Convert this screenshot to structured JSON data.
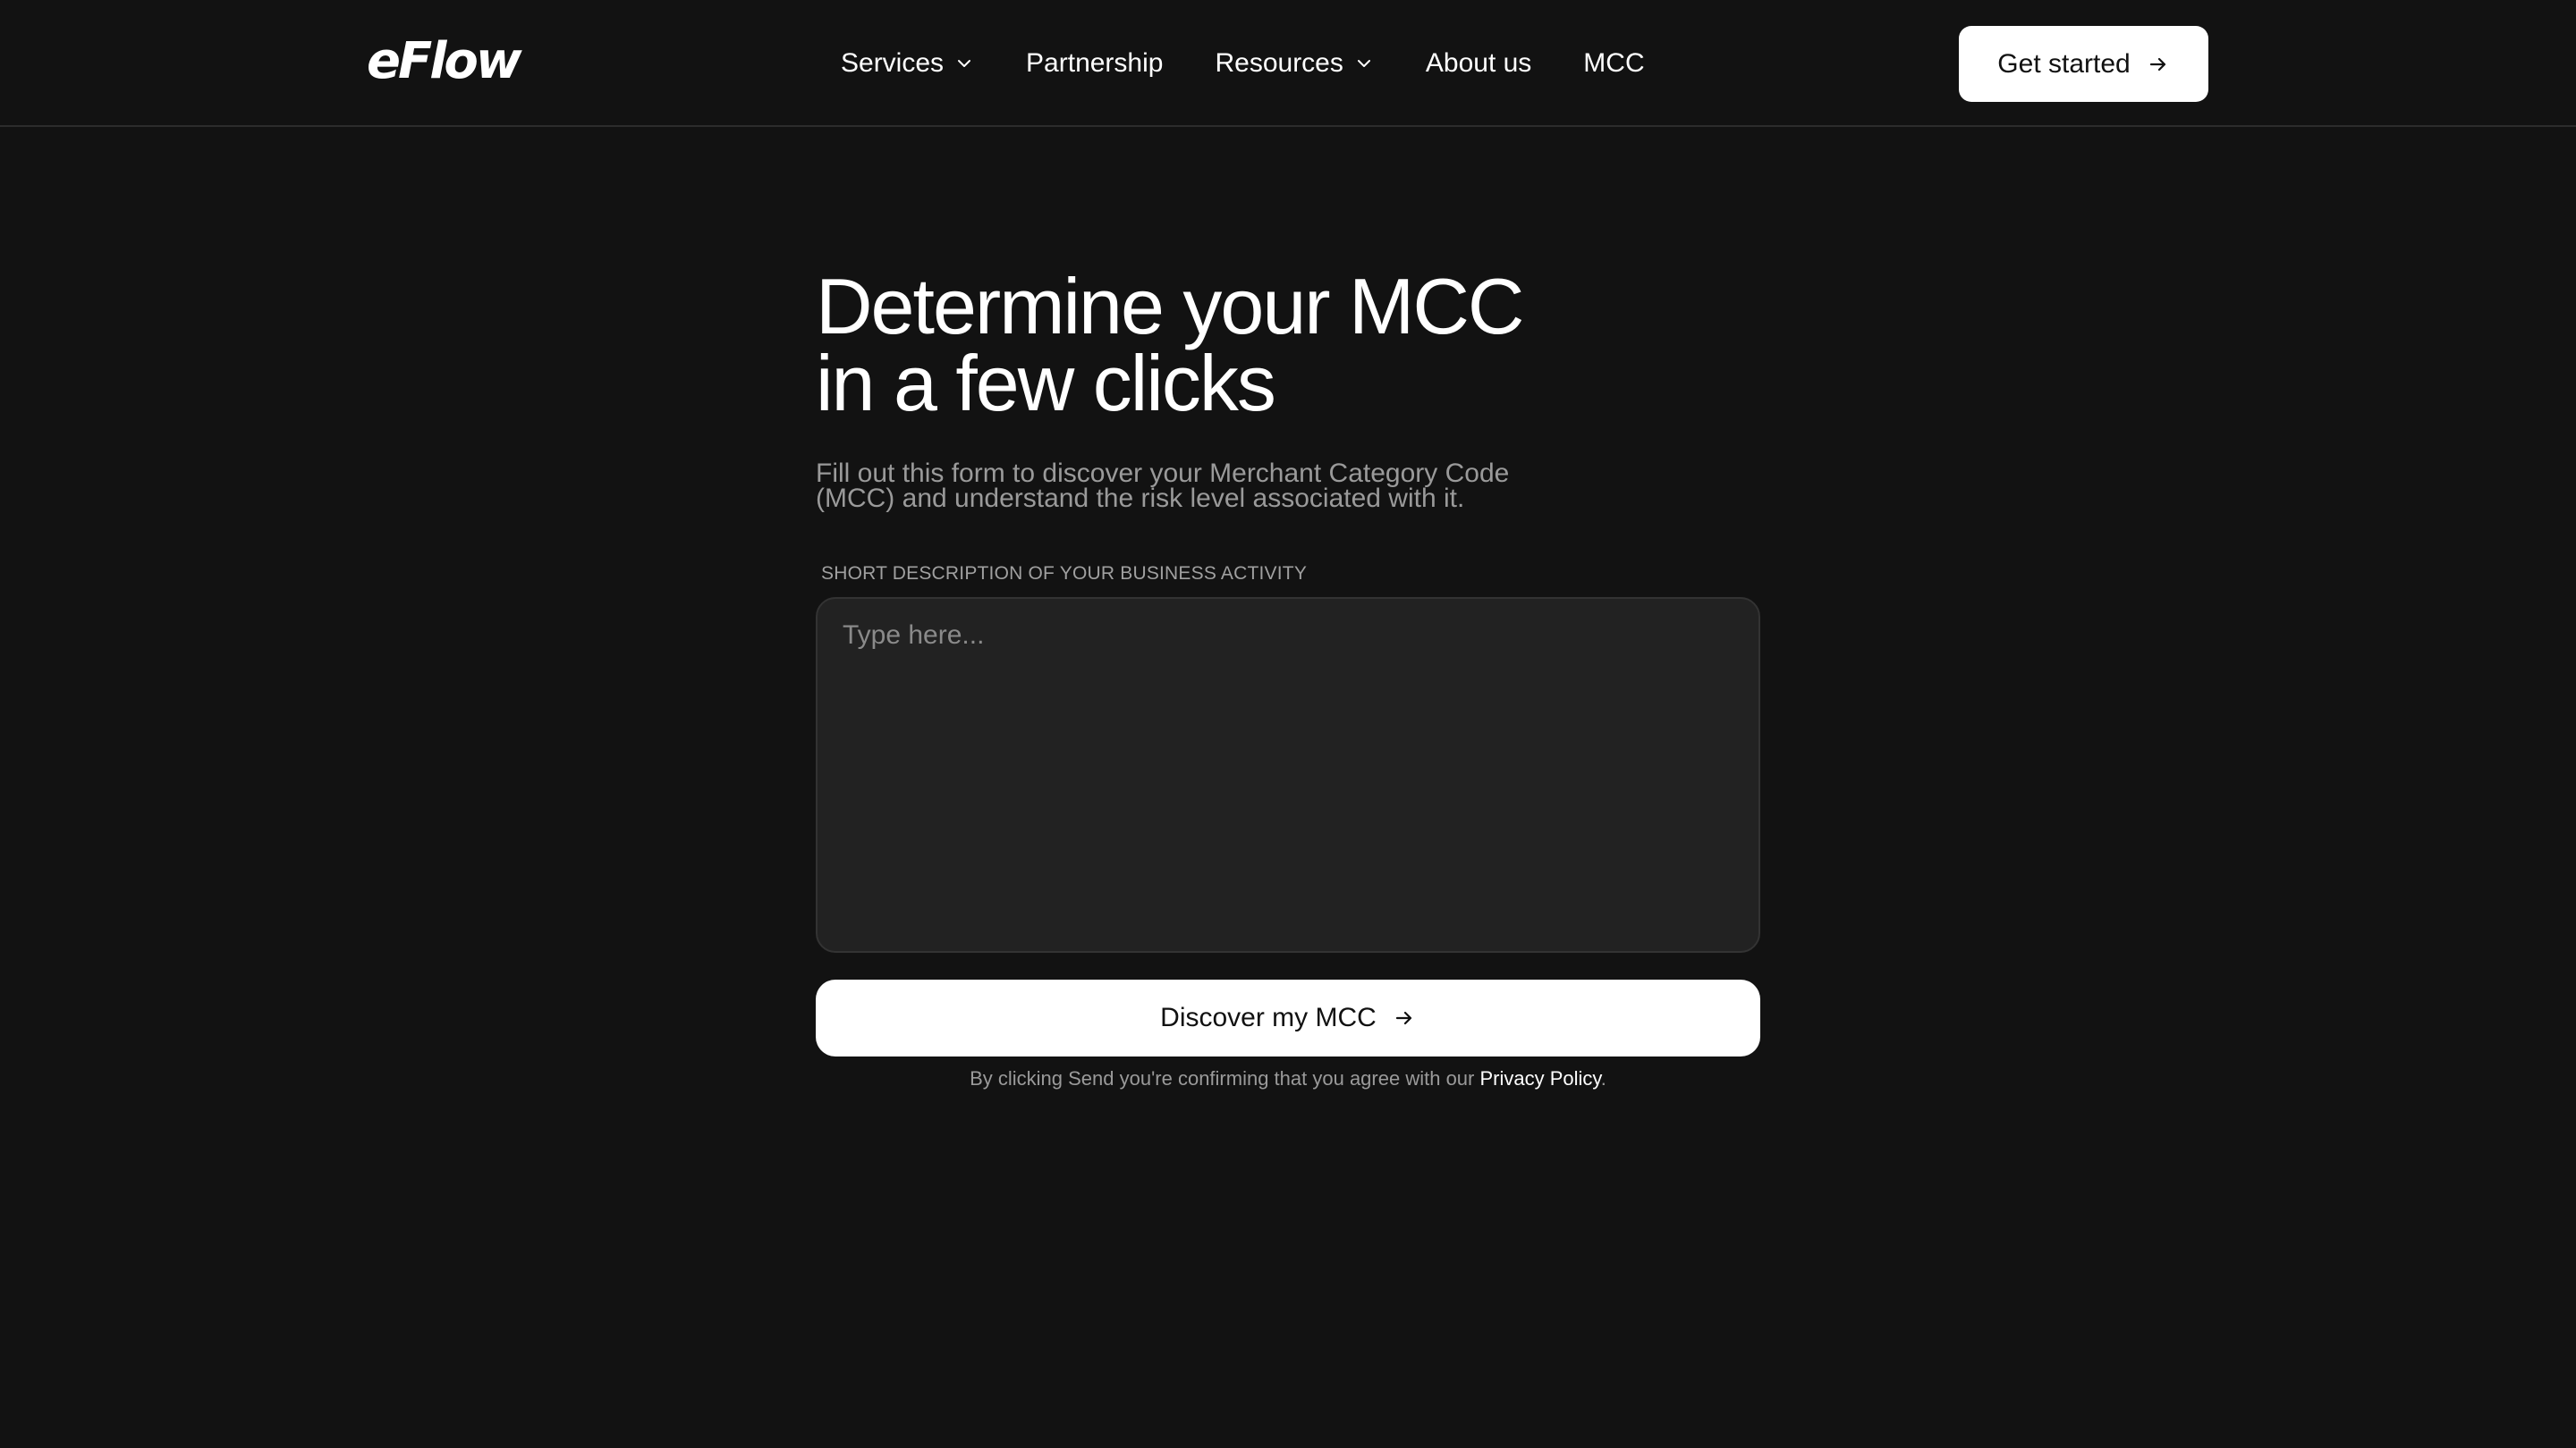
{
  "header": {
    "logo_text": "eFlow",
    "nav": [
      {
        "label": "Services",
        "has_dropdown": true,
        "icon": "chevron-down-icon"
      },
      {
        "label": "Partnership",
        "has_dropdown": false
      },
      {
        "label": "Resources",
        "has_dropdown": true,
        "icon": "chevron-down-icon"
      },
      {
        "label": "About us",
        "has_dropdown": false
      },
      {
        "label": "MCC",
        "has_dropdown": false
      }
    ],
    "cta_label": "Get started",
    "cta_icon": "arrow-right-icon"
  },
  "main": {
    "title_line1": "Determine your MCC",
    "title_line2": "in a few clicks",
    "subtitle": "Fill out this form to discover your Merchant Category Code (MCC) and understand the risk level associated with it.",
    "field_label": "SHORT DESCRIPTION OF YOUR BUSINESS ACTIVITY",
    "field_placeholder": "Type here...",
    "field_value": "",
    "submit_label": "Discover my MCC",
    "submit_icon": "arrow-right-icon",
    "disclaimer_text": "By clicking Send you're confirming that you agree with our ",
    "privacy_link": "Privacy Policy",
    "disclaimer_end": "."
  },
  "colors": {
    "background": "#121212",
    "text": "#ffffff",
    "muted_text": "#9a9a9a",
    "field_bg": "#222222",
    "button_bg": "#ffffff",
    "button_text": "#111111"
  }
}
